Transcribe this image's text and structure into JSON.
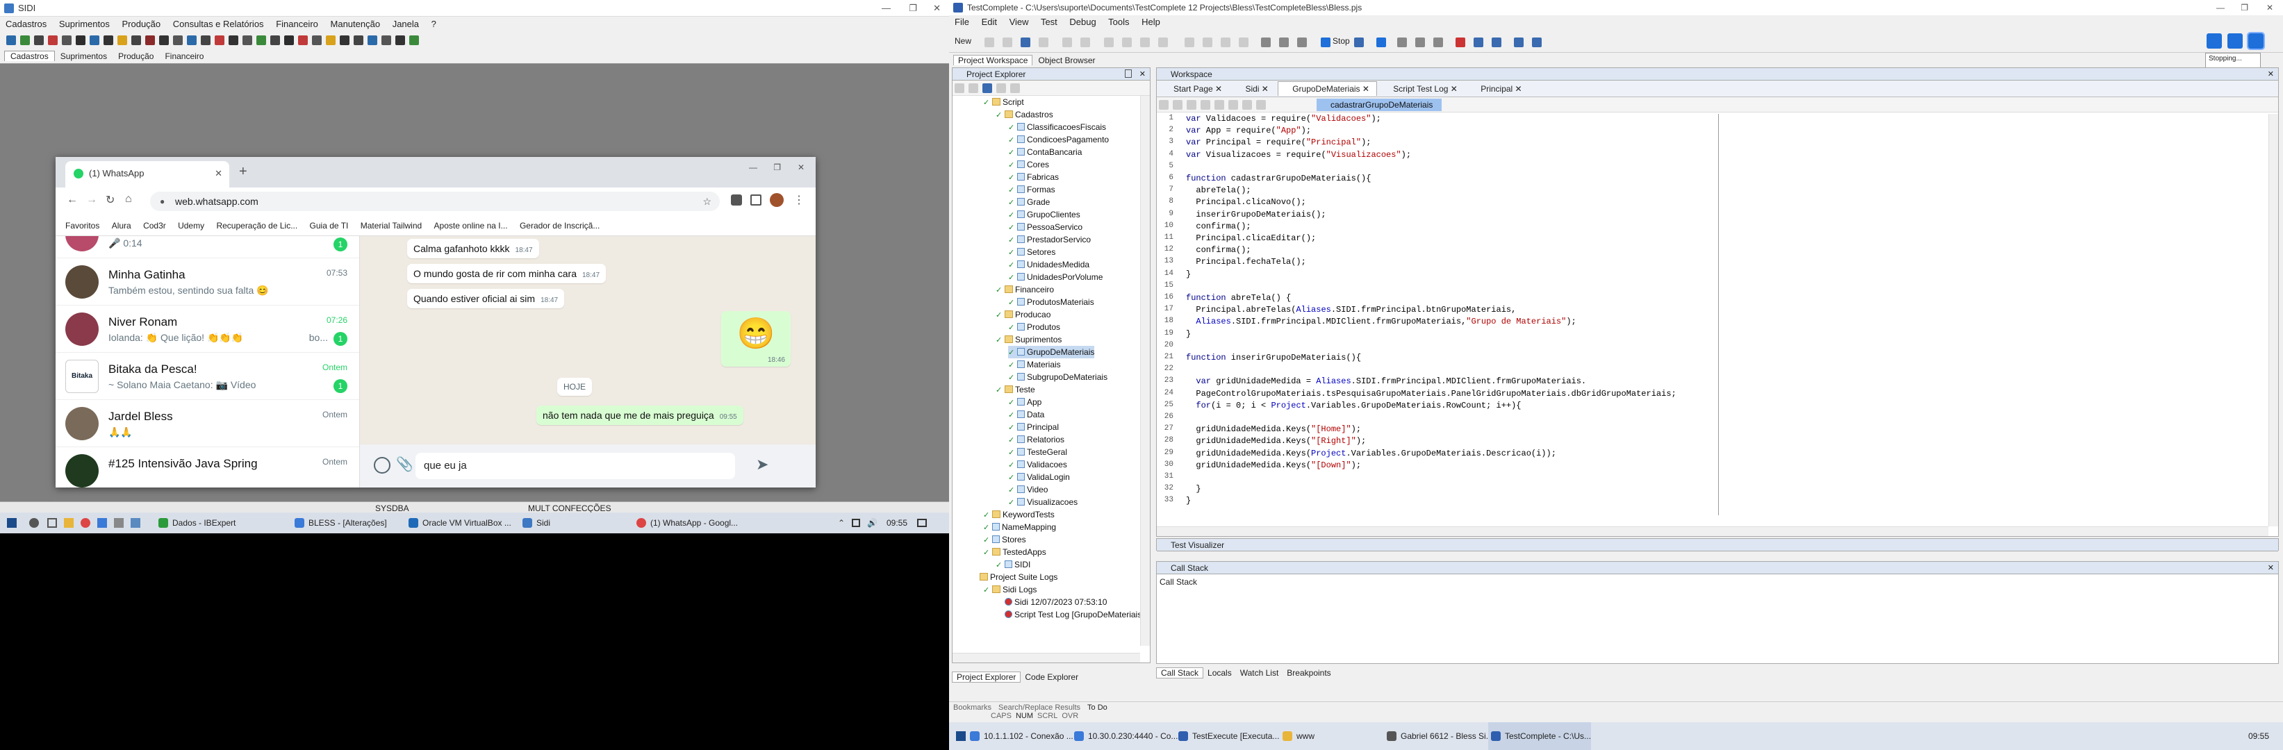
{
  "left_monitor": {
    "sidi": {
      "title": "SIDI",
      "menu": [
        "Cadastros",
        "Suprimentos",
        "Produção",
        "Consultas e Relatórios",
        "Financeiro",
        "Manutenção",
        "Janela",
        "?"
      ],
      "tabs": [
        "Cadastros",
        "Suprimentos",
        "Produção",
        "Financeiro"
      ],
      "status": [
        "SYSDBA",
        "MULT CONFECÇÕES"
      ]
    },
    "whatsapp": {
      "tab_title": "(1) WhatsApp",
      "url": "web.whatsapp.com",
      "bookmarks": [
        "Favoritos",
        "Alura",
        "Cod3r",
        "Udemy",
        "Recuperação de Lic...",
        "Guia de TI",
        "Material Tailwind",
        "Aposte online na I...",
        "Gerador de Inscriçã..."
      ],
      "chats": [
        {
          "name": "",
          "message": "0:14",
          "time": "",
          "badge": "1"
        },
        {
          "name": "Minha Gatinha",
          "message": "Também estou, sentindo sua falta 😊",
          "time": "07:53",
          "badge": ""
        },
        {
          "name": "Niver  Ronam",
          "message": "Iolanda: 👏 Que lição! 👏👏👏",
          "time": "07:26",
          "badge": "1",
          "extra": "bo..."
        },
        {
          "name": "Bitaka da Pesca!",
          "message": "~ Solano Maia Caetano: 📷 Vídeo",
          "time": "Ontem",
          "badge": "1"
        },
        {
          "name": "Jardel Bless",
          "message": "🙏🙏",
          "time": "Ontem",
          "badge": ""
        },
        {
          "name": "#125 Intensivão Java Spring",
          "message": "",
          "time": "Ontem",
          "badge": ""
        }
      ],
      "messages": [
        {
          "text": "Calma gafanhoto kkkk",
          "time": "18:47"
        },
        {
          "text": "O mundo gosta de rir com minha cara",
          "time": "18:47"
        },
        {
          "text": "Quando estiver oficial ai sim",
          "time": "18:47"
        },
        {
          "text": "😁",
          "time": "18:46"
        },
        {
          "text": "HOJE",
          "time": ""
        },
        {
          "text": "não tem nada que me de mais preguiça",
          "time": "09:55"
        }
      ],
      "compose_text": "que eu ja"
    },
    "taskbar": {
      "items": [
        "Dados - IBExpert",
        "BLESS - [Alterações]",
        "Oracle VM VirtualBox ...",
        "Sidi",
        "(1) WhatsApp - Googl..."
      ],
      "clock": "09:55"
    }
  },
  "right_monitor": {
    "title": "TestComplete - C:\\Users\\suporte\\Documents\\TestComplete 12 Projects\\Bless\\TestCompleteBless\\Bless.pjs",
    "menu": [
      "File",
      "Edit",
      "View",
      "Test",
      "Debug",
      "Tools",
      "Help"
    ],
    "toolbar": {
      "new_label": "New",
      "stop_label": "Stop",
      "status_popup": "Stopping..."
    },
    "tabs_top": [
      "Project Workspace",
      "Object Browser"
    ],
    "project_explorer": {
      "title": "Project Explorer",
      "tree": [
        {
          "label": "Script",
          "level": 0,
          "type": "folder"
        },
        {
          "label": "Cadastros",
          "level": 1,
          "type": "folder"
        },
        {
          "label": "ClassificacoesFiscais",
          "level": 2,
          "type": "unit"
        },
        {
          "label": "CondicoesPagamento",
          "level": 2,
          "type": "unit"
        },
        {
          "label": "ContaBancaria",
          "level": 2,
          "type": "unit"
        },
        {
          "label": "Cores",
          "level": 2,
          "type": "unit"
        },
        {
          "label": "Fabricas",
          "level": 2,
          "type": "unit"
        },
        {
          "label": "Formas",
          "level": 2,
          "type": "unit"
        },
        {
          "label": "Grade",
          "level": 2,
          "type": "unit"
        },
        {
          "label": "GrupoClientes",
          "level": 2,
          "type": "unit"
        },
        {
          "label": "PessoaServico",
          "level": 2,
          "type": "unit"
        },
        {
          "label": "PrestadorServico",
          "level": 2,
          "type": "unit"
        },
        {
          "label": "Setores",
          "level": 2,
          "type": "unit"
        },
        {
          "label": "UnidadesMedida",
          "level": 2,
          "type": "unit"
        },
        {
          "label": "UnidadesPorVolume",
          "level": 2,
          "type": "unit"
        },
        {
          "label": "Financeiro",
          "level": 1,
          "type": "folder"
        },
        {
          "label": "ProdutosMateriais",
          "level": 2,
          "type": "unit"
        },
        {
          "label": "Producao",
          "level": 1,
          "type": "folder"
        },
        {
          "label": "Produtos",
          "level": 2,
          "type": "unit"
        },
        {
          "label": "Suprimentos",
          "level": 1,
          "type": "folder"
        },
        {
          "label": "GrupoDeMateriais",
          "level": 2,
          "type": "unit",
          "selected": true
        },
        {
          "label": "Materiais",
          "level": 2,
          "type": "unit"
        },
        {
          "label": "SubgrupoDeMateriais",
          "level": 2,
          "type": "unit"
        },
        {
          "label": "Teste",
          "level": 1,
          "type": "folder"
        },
        {
          "label": "App",
          "level": 2,
          "type": "unit"
        },
        {
          "label": "Data",
          "level": 2,
          "type": "unit"
        },
        {
          "label": "Principal",
          "level": 2,
          "type": "unit"
        },
        {
          "label": "Relatorios",
          "level": 2,
          "type": "unit"
        },
        {
          "label": "TesteGeral",
          "level": 2,
          "type": "unit"
        },
        {
          "label": "Validacoes",
          "level": 2,
          "type": "unit"
        },
        {
          "label": "ValidaLogin",
          "level": 2,
          "type": "unit"
        },
        {
          "label": "Video",
          "level": 2,
          "type": "unit"
        },
        {
          "label": "Visualizacoes",
          "level": 2,
          "type": "unit"
        },
        {
          "label": "KeywordTests",
          "level": 0,
          "type": "folder"
        },
        {
          "label": "NameMapping",
          "level": 0,
          "type": "unit"
        },
        {
          "label": "Stores",
          "level": 0,
          "type": "unit"
        },
        {
          "label": "TestedApps",
          "level": 0,
          "type": "folder"
        },
        {
          "label": "SIDI",
          "level": 1,
          "type": "unit"
        },
        {
          "label": "Project Suite Logs",
          "level": -1,
          "type": "folder"
        },
        {
          "label": "Sidi Logs",
          "level": 0,
          "type": "folder"
        },
        {
          "label": "Sidi 12/07/2023 07:53:10",
          "level": 1,
          "type": "log"
        },
        {
          "label": "Script Test Log [GrupoDeMateriais\\pada",
          "level": 1,
          "type": "log"
        }
      ],
      "bottom_tabs": [
        "Project Explorer",
        "Code Explorer"
      ]
    },
    "workspace": {
      "title": "Workspace",
      "tabs": [
        "Start Page",
        "Sidi",
        "GrupoDeMateriais",
        "Script Test Log",
        "Principal"
      ],
      "routine": "cadastrarGrupoDeMateriais",
      "line_numbers": [
        "1",
        "2",
        "3",
        "4",
        "5",
        "6",
        "7",
        "8",
        "9",
        "10",
        "11",
        "12",
        "13",
        "14",
        "15",
        "16",
        "17",
        "18",
        "19",
        "20",
        "21",
        "22",
        "23",
        "24",
        "25",
        "26",
        "27",
        "28",
        "29",
        "30",
        "31",
        "32",
        "33"
      ],
      "code_lines": [
        "var Validacoes = require(\"Validacoes\");",
        "var App = require(\"App\");",
        "var Principal = require(\"Principal\");",
        "var Visualizacoes = require(\"Visualizacoes\");",
        "",
        "function cadastrarGrupoDeMateriais(){",
        "  abreTela();",
        "  Principal.clicaNovo();",
        "  inserirGrupoDeMateriais();",
        "  confirma();",
        "  Principal.clicaEditar();",
        "  confirma();",
        "  Principal.fechaTela();",
        "}",
        "",
        "function abreTela() {",
        "  Principal.abreTelas(Aliases.SIDI.frmPrincipal.btnGrupoMateriais,",
        "  Aliases.SIDI.frmPrincipal.MDIClient.frmGrupoMateriais,\"Grupo de Materiais\");",
        "}",
        "",
        "function inserirGrupoDeMateriais(){",
        "",
        "  var gridUnidadeMedida = Aliases.SIDI.frmPrincipal.MDIClient.frmGrupoMateriais.",
        "  PageControlGrupoMateriais.tsPesquisaGrupoMateriais.PanelGridGrupoMateriais.dbGridGrupoMateriais;",
        "  for(i = 0; i < Project.Variables.GrupoDeMateriais.RowCount; i++){",
        "",
        "  gridUnidadeMedida.Keys(\"[Home]\");",
        "  gridUnidadeMedida.Keys(\"[Right]\");",
        "  gridUnidadeMedida.Keys(Project.Variables.GrupoDeMateriais.Descricao(i));",
        "  gridUnidadeMedida.Keys(\"[Down]\");",
        "",
        "  }",
        "}"
      ]
    },
    "test_visualizer": {
      "title": "Test Visualizer"
    },
    "call_stack": {
      "title": "Call Stack",
      "content": "Call Stack"
    },
    "bottom_tabs": [
      "Call Stack",
      "Locals",
      "Watch List",
      "Breakpoints"
    ],
    "footer_tabs": [
      "Bookmarks",
      "Search/Replace Results",
      "To Do"
    ],
    "status_keys": [
      "CAPS",
      "NUM",
      "SCRL",
      "OVR"
    ],
    "taskbar": {
      "items": [
        "10.1.1.102 - Conexão ...",
        "10.30.0.230:4440 - Co...",
        "TestExecute [Executa...",
        "www",
        "Gabriel 6612 - Bless Si...",
        "TestComplete - C:\\Us..."
      ],
      "clock": "09:55"
    }
  }
}
